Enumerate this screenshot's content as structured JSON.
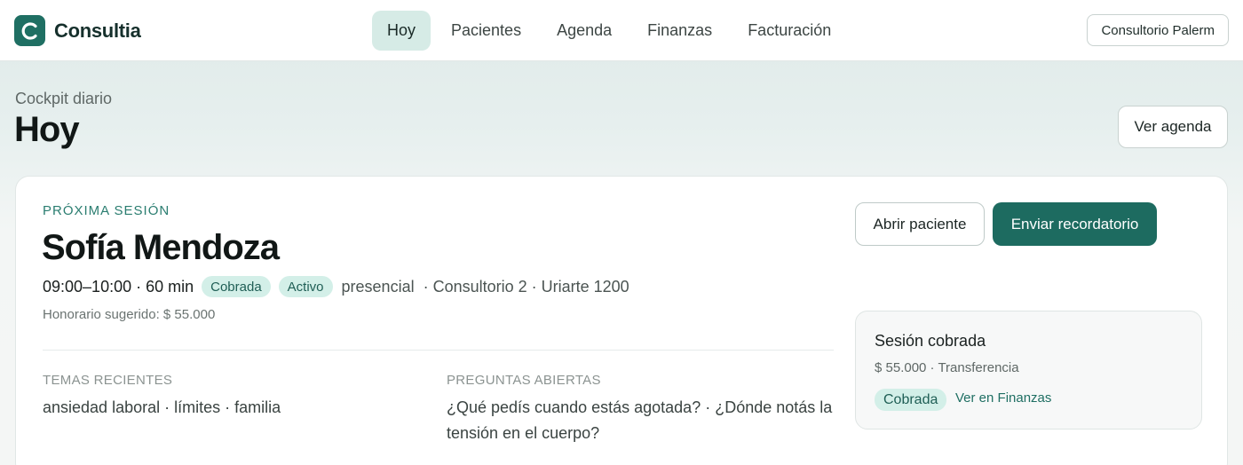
{
  "brand": {
    "name": "Consultia"
  },
  "nav": {
    "items": [
      {
        "label": "Hoy",
        "active": true
      },
      {
        "label": "Pacientes",
        "active": false
      },
      {
        "label": "Agenda",
        "active": false
      },
      {
        "label": "Finanzas",
        "active": false
      },
      {
        "label": "Facturación",
        "active": false
      }
    ],
    "org_label": "Consultorio Palerm"
  },
  "header": {
    "eyebrow": "Cockpit diario",
    "title": "Hoy",
    "agenda_button": "Ver agenda"
  },
  "next_session": {
    "eyebrow": "PRÓXIMA SESIÓN",
    "patient_name": "Sofía Mendoza",
    "time": "09:00–10:00 · 60 min",
    "badges": [
      "Cobrada",
      "Activo"
    ],
    "modality": "presencial",
    "location": "· Consultorio 2 · Uriarte 1200",
    "fee": "Honorario sugerido: $ 55.000",
    "open_patient_button": "Abrir paciente",
    "send_reminder_button": "Enviar recordatorio",
    "recent_topics": {
      "title": "TEMAS RECIENTES",
      "text": "ansiedad laboral · límites · familia"
    },
    "open_questions": {
      "title": "PREGUNTAS ABIERTAS",
      "text": "¿Qué pedís cuando estás agotada? · ¿Dónde notás la tensión en el cuerpo?"
    },
    "payment": {
      "title": "Sesión cobrada",
      "detail": "$ 55.000 · Transferencia",
      "badge": "Cobrada",
      "link": "Ver en Finanzas"
    }
  },
  "colors": {
    "accent": "#1d6b60",
    "badge_bg": "#d3efe8",
    "badge_text": "#1f5e55"
  }
}
